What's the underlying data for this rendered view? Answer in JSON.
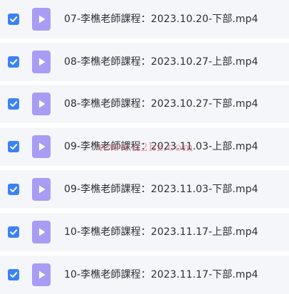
{
  "colors": {
    "row_background": "#f5f6fa",
    "checkbox_checked": "#3b82f6",
    "file_icon": "#a89cf5",
    "text": "#2b2f36",
    "watermark": "#e8555f"
  },
  "files": [
    {
      "name": "07-李樵老師課程：2023.10.20-下部.mp4",
      "checked": true,
      "icon": "video-file-icon"
    },
    {
      "name": "08-李樵老師課程：2023.10.27-上部.mp4",
      "checked": true,
      "icon": "video-file-icon"
    },
    {
      "name": "08-李樵老師課程：2023.10.27-下部.mp4",
      "checked": true,
      "icon": "video-file-icon"
    },
    {
      "name": "09-李樵老師課程：2023.11.03-上部.mp4",
      "checked": true,
      "icon": "video-file-icon"
    },
    {
      "name": "09-李樵老師課程：2023.11.03-下部.mp4",
      "checked": true,
      "icon": "video-file-icon"
    },
    {
      "name": "10-李樵老師課程：2023.11.17-上部.mp4",
      "checked": true,
      "icon": "video-file-icon"
    },
    {
      "name": "10-李樵老師課程：2023.11.17-下部.mp4",
      "checked": true,
      "icon": "video-file-icon"
    }
  ],
  "watermark": {
    "text": "www.n2hz.com"
  }
}
